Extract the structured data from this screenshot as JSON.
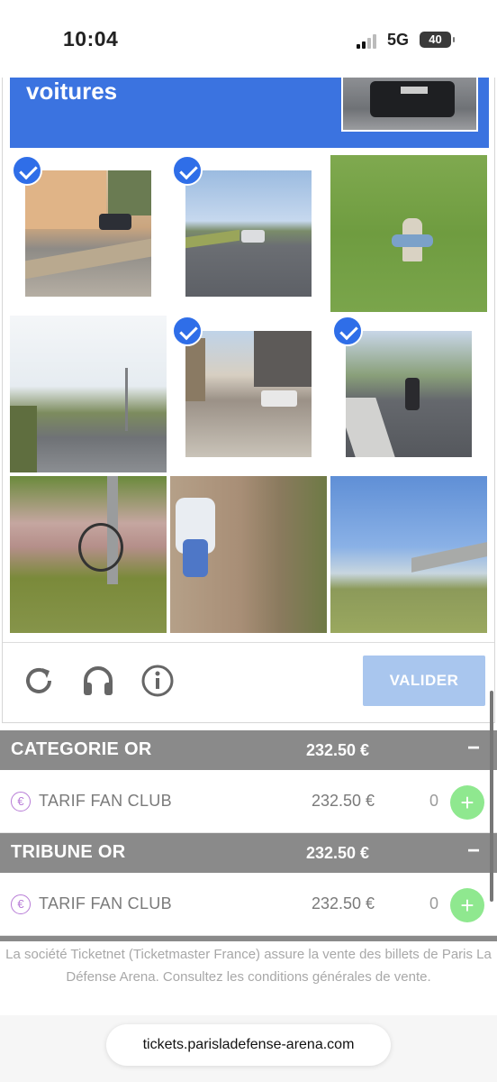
{
  "status_bar": {
    "time": "10:04",
    "network": "5G",
    "battery": "40"
  },
  "captcha": {
    "banner_text": "voitures",
    "tiles": [
      {
        "name": "tile-1",
        "selected": true
      },
      {
        "name": "tile-2",
        "selected": true
      },
      {
        "name": "tile-3",
        "selected": false
      },
      {
        "name": "tile-4",
        "selected": false
      },
      {
        "name": "tile-5",
        "selected": true
      },
      {
        "name": "tile-6",
        "selected": true
      },
      {
        "name": "tile-7",
        "selected": false
      },
      {
        "name": "tile-8",
        "selected": false
      },
      {
        "name": "tile-9",
        "selected": false
      }
    ],
    "icons": [
      "refresh-icon",
      "headphones-icon",
      "info-icon"
    ],
    "submit_label": "VALIDER"
  },
  "categories": [
    {
      "name": "CATEGORIE OR",
      "price": "232.50 €",
      "toggle": "−",
      "rate": {
        "icon": "€",
        "name": "TARIF FAN CLUB",
        "price": "232.50 €",
        "quantity": "0",
        "add": "+"
      }
    },
    {
      "name": "TRIBUNE OR",
      "price": "232.50 €",
      "toggle": "−",
      "rate": {
        "icon": "€",
        "name": "TARIF FAN CLUB",
        "price": "232.50 €",
        "quantity": "0",
        "add": "+"
      }
    }
  ],
  "legal_text": "La société Ticketnet (Ticketmaster France) assure la vente des billets de Paris La Défense Arena. Consultez les conditions générales de vente.",
  "url": "tickets.parisladefense-arena.com",
  "colors": {
    "banner": "#3b73e0",
    "check": "#2f6ee8",
    "submit": "#a9c6ee",
    "category_bar": "#8a8a8a",
    "add_button": "#8fe88f",
    "euro_icon": "#b77bd6"
  }
}
